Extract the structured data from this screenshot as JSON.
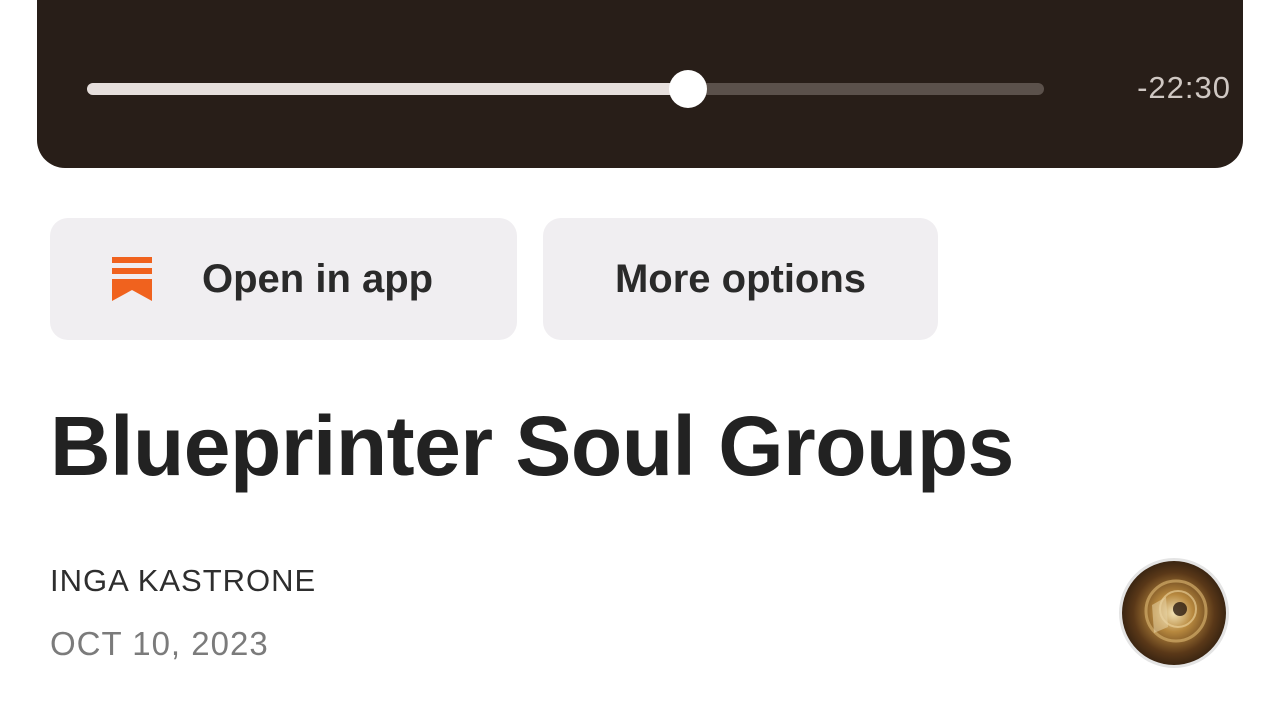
{
  "player": {
    "progress": 0.628,
    "time_remaining": "-22:30"
  },
  "actions": {
    "open_in_app": "Open in app",
    "more_options": "More options",
    "open_icon": "bookmark-icon",
    "accent_color": "#f0621e"
  },
  "post": {
    "title": "Blueprinter Soul Groups",
    "author": "INGA KASTRONE",
    "date": "OCT 10, 2023",
    "avatar_icon": "author-avatar"
  }
}
